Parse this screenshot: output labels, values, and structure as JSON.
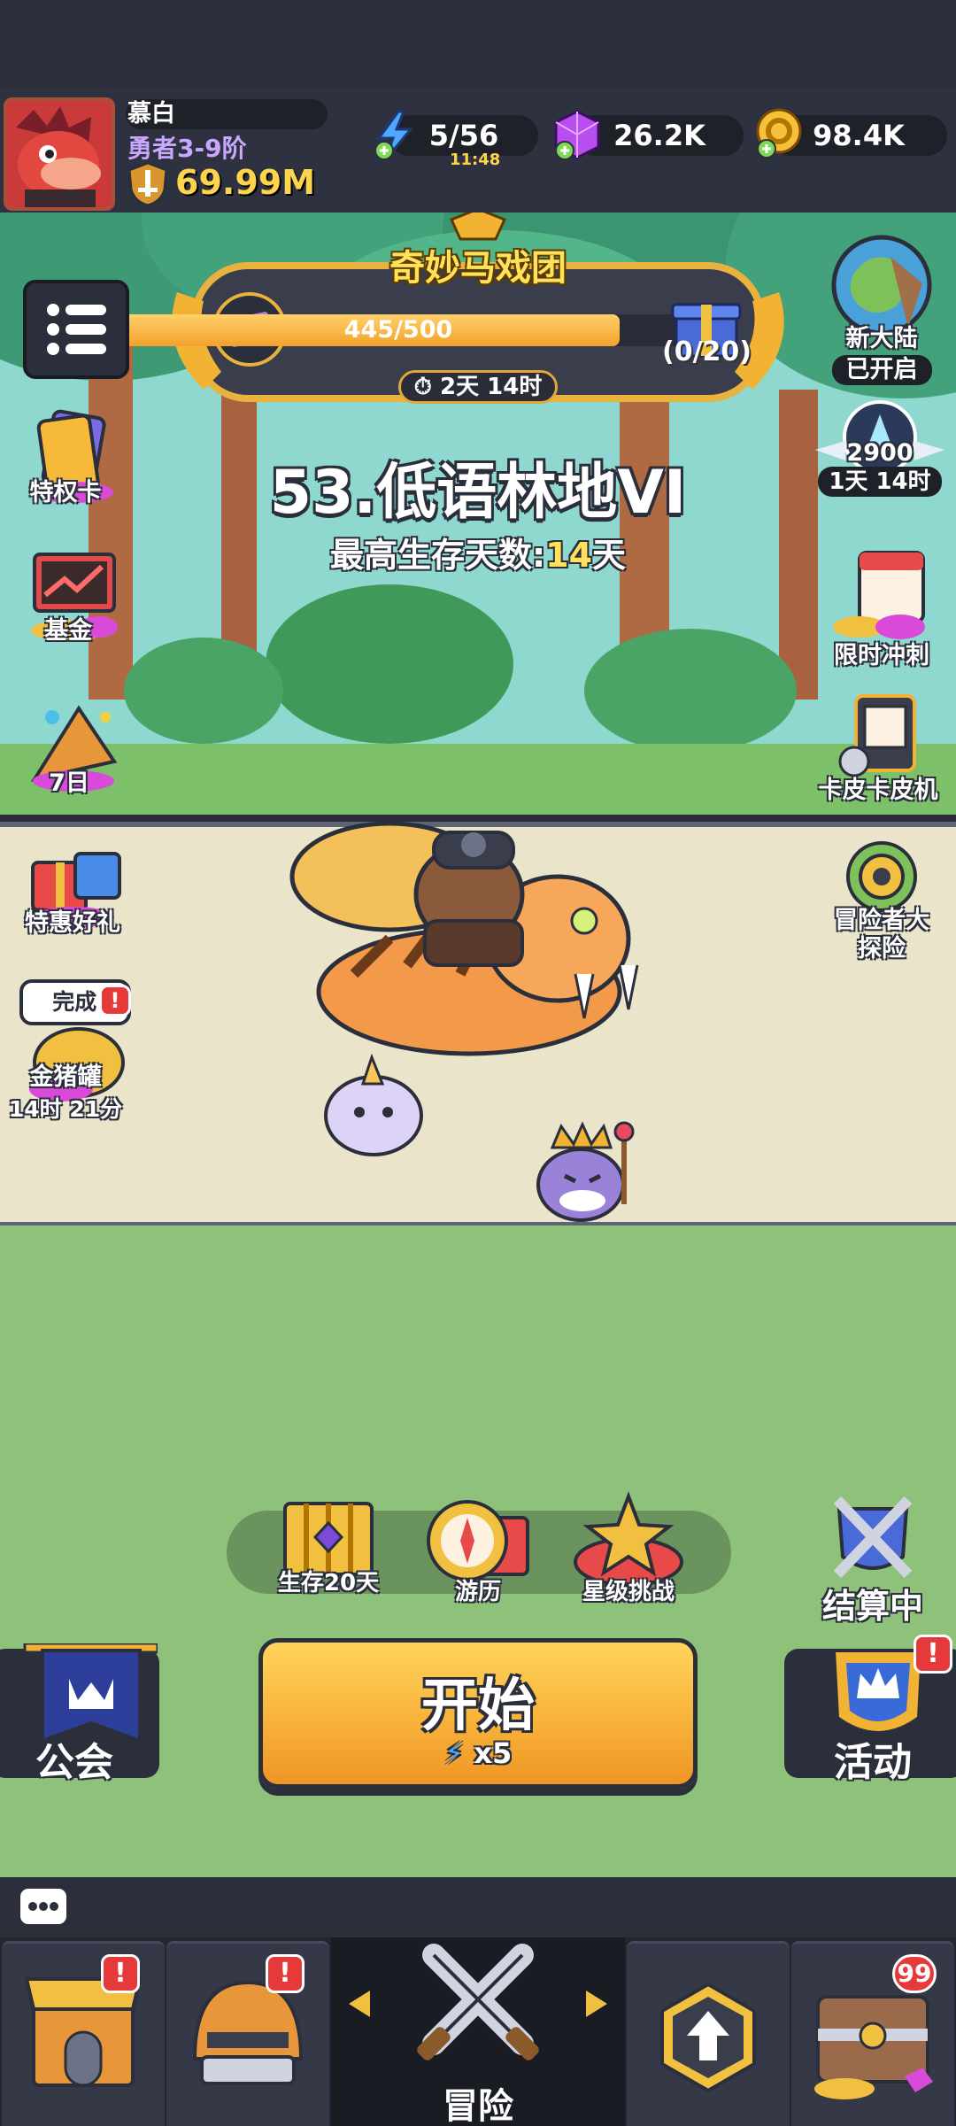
{
  "player": {
    "name": "慕白",
    "rank": "勇者3-9阶",
    "power": "69.99M"
  },
  "resources": {
    "energy": "5/56",
    "energy_timer": "11:48",
    "gems": "26.2K",
    "gold": "98.4K"
  },
  "event": {
    "title": "奇妙马戏团",
    "progress_text": "445/500",
    "progress": 0.89,
    "reward_count": "(0/20)",
    "timer": "2天 14时"
  },
  "stage": {
    "title": "53.低语林地VI",
    "best_label": "最高生存天数:",
    "best_value": "14",
    "best_unit": "天"
  },
  "left_icons": {
    "privilege": "特权卡",
    "fund": "基金",
    "seven_day": "7日",
    "deal": "特惠好礼",
    "piggy_done": "完成!",
    "piggy": "金猪罐",
    "piggy_timer": "14时 21分"
  },
  "right_icons": {
    "new_land": "新大陆",
    "new_land_status": "已开启",
    "rank_score": "2900",
    "rank_timer": "1天 14时",
    "sprint": "限时冲刺",
    "skin": "卡皮卡皮机",
    "adventure": "冒险者大探险"
  },
  "actions": {
    "survive": "生存20天",
    "travel": "游历",
    "star": "星级挑战",
    "settle": "结算中"
  },
  "start": {
    "label": "开始",
    "cost": "x5"
  },
  "guild": "公会",
  "activity": "活动",
  "nav": {
    "adventure": "冒险",
    "chest_count": "99"
  },
  "colors": {
    "accent_orange": "#f8b33a",
    "badge_red": "#e63a3a",
    "panel_dark": "#2b2e3b"
  }
}
